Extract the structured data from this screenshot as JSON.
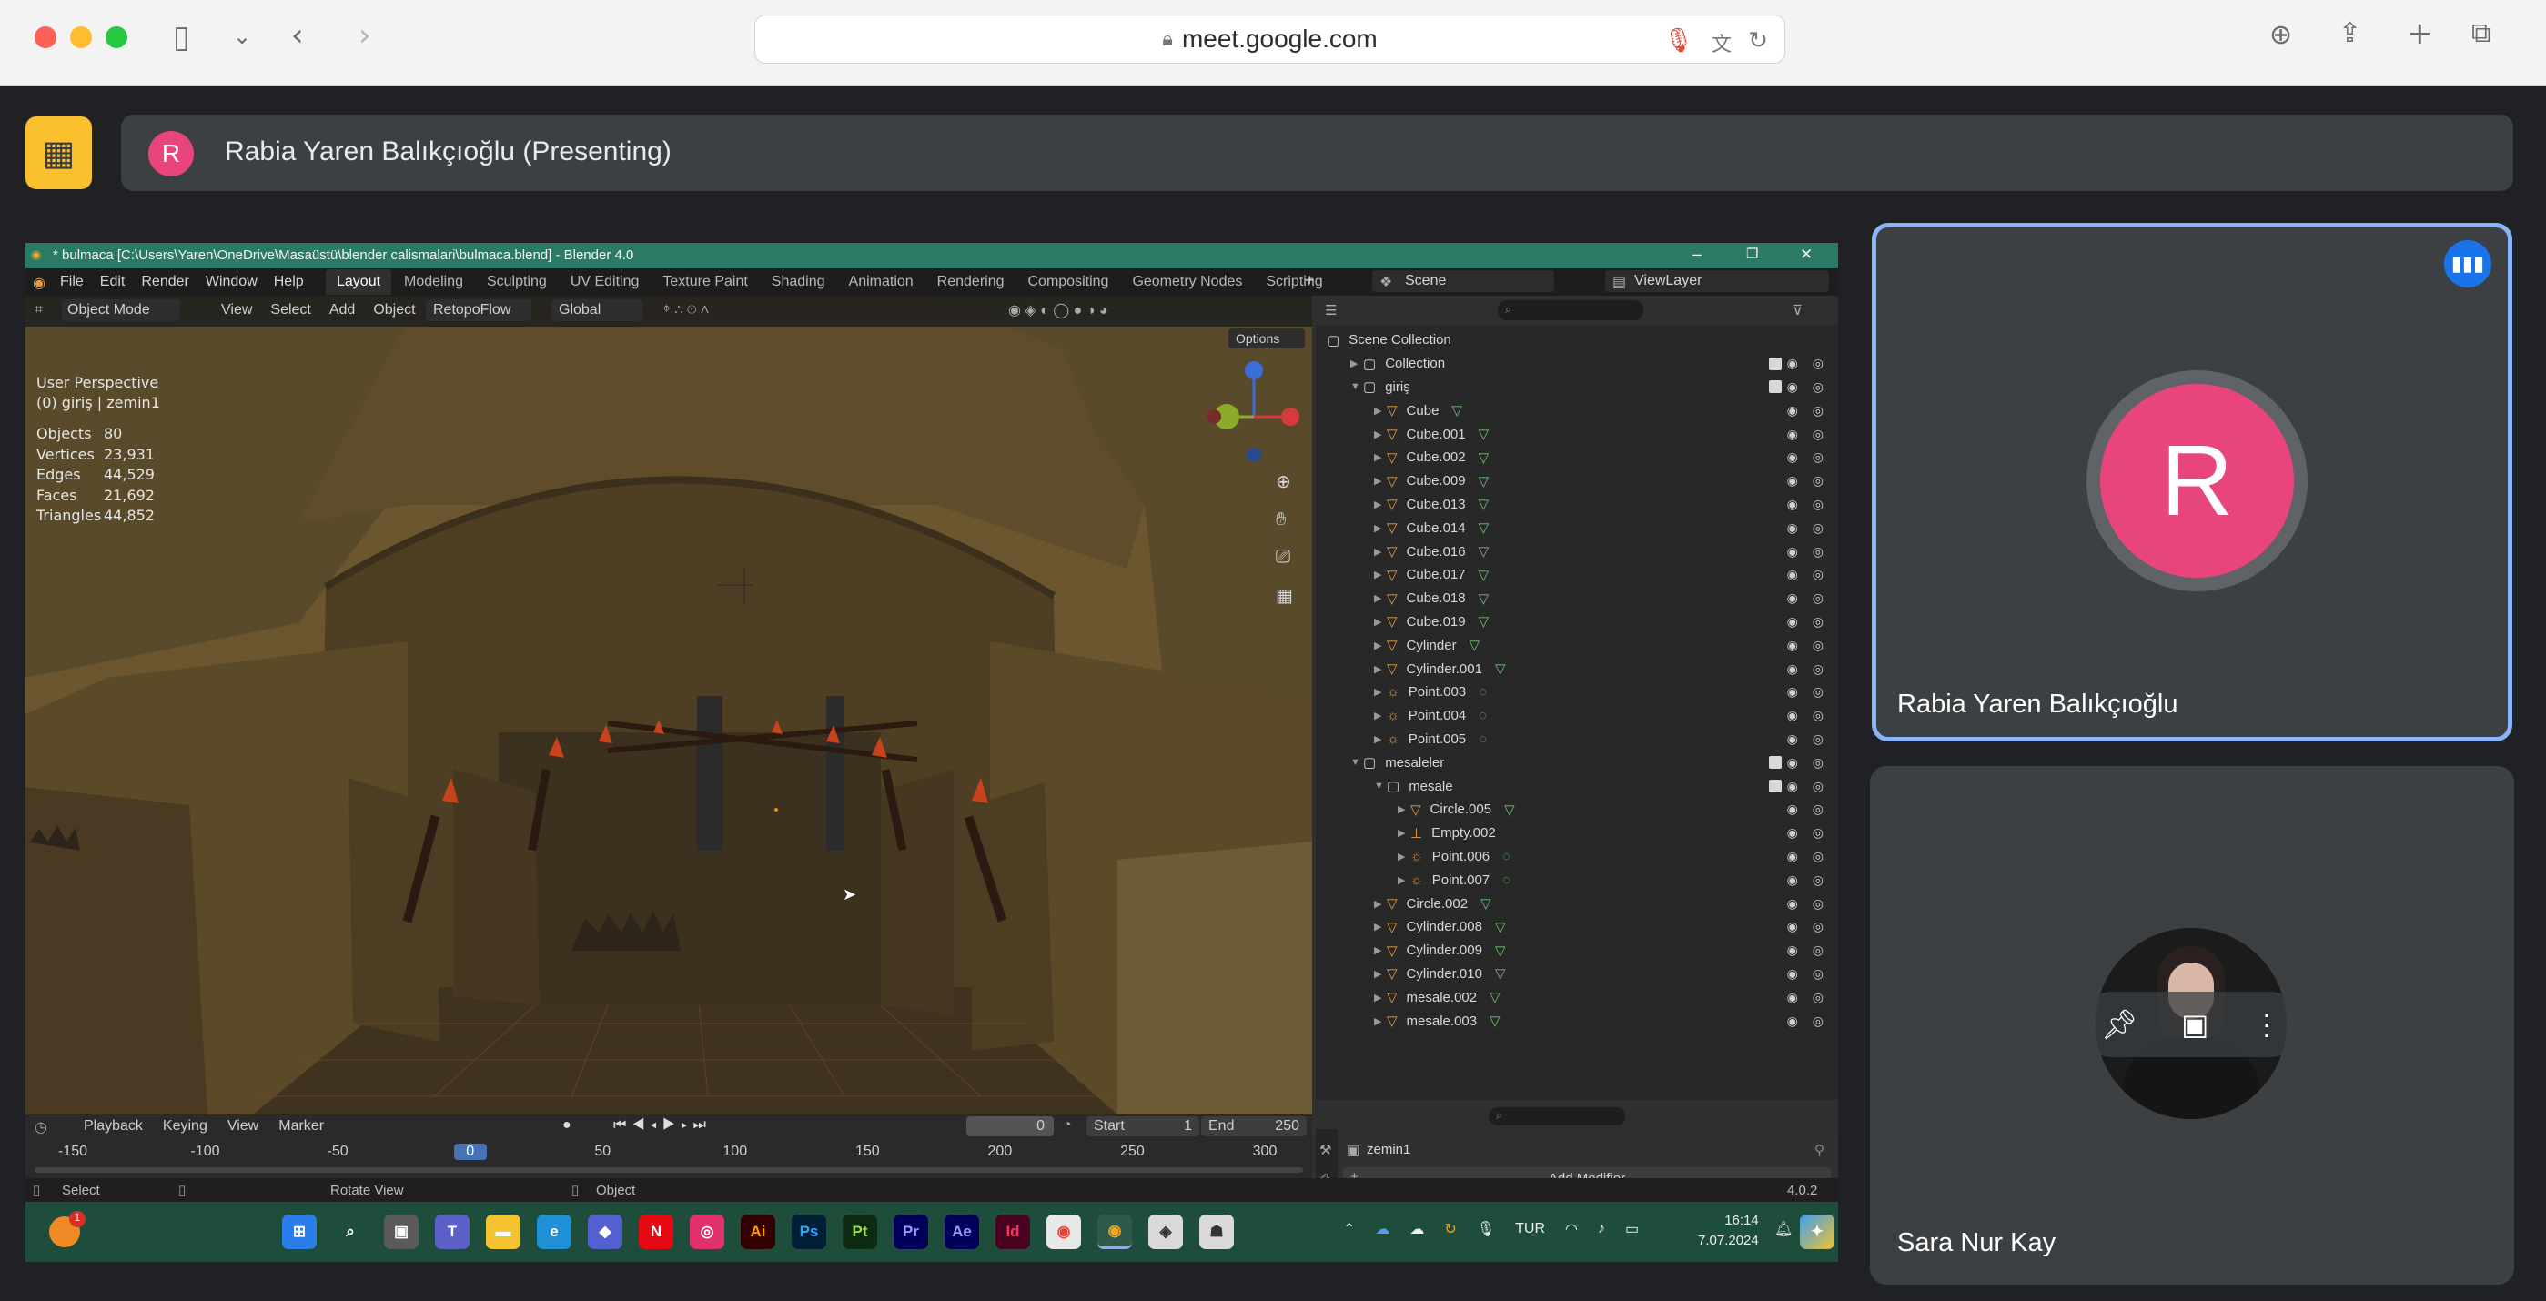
{
  "browser": {
    "url": "meet.google.com"
  },
  "meet": {
    "presenter_initial": "R",
    "presenting_label": "Rabia Yaren Balıkçıoğlu (Presenting)",
    "participants": [
      {
        "initial": "R",
        "name": "Rabia Yaren Balıkçıoğlu",
        "avatar_color": "#e8457c"
      },
      {
        "name": "Sara Nur Kay"
      }
    ],
    "accent": "#8ab4f8"
  },
  "blender": {
    "window_title": "* bulmaca [C:\\Users\\Yaren\\OneDrive\\Masaüstü\\blender calismalari\\bulmaca.blend] - Blender 4.0",
    "menu": [
      "File",
      "Edit",
      "Render",
      "Window",
      "Help"
    ],
    "workspaces": [
      "Layout",
      "Modeling",
      "Sculpting",
      "UV Editing",
      "Texture Paint",
      "Shading",
      "Animation",
      "Rendering",
      "Compositing",
      "Geometry Nodes",
      "Scripting"
    ],
    "active_workspace": "Layout",
    "scene": "Scene",
    "view_layer": "ViewLayer",
    "viewport_header": {
      "mode": "Object Mode",
      "items": [
        "View",
        "Select",
        "Add",
        "Object"
      ],
      "addon": "RetopoFlow",
      "transform": "Global",
      "options": "Options"
    },
    "overlay": {
      "perspective": "User Perspective",
      "context": "(0) giriş | zemin1",
      "stats": [
        {
          "label": "Objects",
          "value": "80"
        },
        {
          "label": "Vertices",
          "value": "23,931"
        },
        {
          "label": "Edges",
          "value": "44,529"
        },
        {
          "label": "Faces",
          "value": "21,692"
        },
        {
          "label": "Triangles",
          "value": "44,852"
        }
      ]
    },
    "outliner": [
      {
        "name": "Scene Collection",
        "indent": 0,
        "kind": "scene"
      },
      {
        "name": "Collection",
        "indent": 1,
        "kind": "collection",
        "check": true
      },
      {
        "name": "giriş",
        "indent": 1,
        "kind": "collection",
        "check": true,
        "open": true
      },
      {
        "name": "Cube",
        "indent": 2,
        "kind": "mesh"
      },
      {
        "name": "Cube.001",
        "indent": 2,
        "kind": "mesh"
      },
      {
        "name": "Cube.002",
        "indent": 2,
        "kind": "mesh"
      },
      {
        "name": "Cube.009",
        "indent": 2,
        "kind": "mesh"
      },
      {
        "name": "Cube.013",
        "indent": 2,
        "kind": "mesh"
      },
      {
        "name": "Cube.014",
        "indent": 2,
        "kind": "mesh"
      },
      {
        "name": "Cube.016",
        "indent": 2,
        "kind": "mesh"
      },
      {
        "name": "Cube.017",
        "indent": 2,
        "kind": "mesh"
      },
      {
        "name": "Cube.018",
        "indent": 2,
        "kind": "mesh"
      },
      {
        "name": "Cube.019",
        "indent": 2,
        "kind": "mesh"
      },
      {
        "name": "Cylinder",
        "indent": 2,
        "kind": "mesh"
      },
      {
        "name": "Cylinder.001",
        "indent": 2,
        "kind": "mesh"
      },
      {
        "name": "Point.003",
        "indent": 2,
        "kind": "light"
      },
      {
        "name": "Point.004",
        "indent": 2,
        "kind": "light"
      },
      {
        "name": "Point.005",
        "indent": 2,
        "kind": "light"
      },
      {
        "name": "mesaleler",
        "indent": 1,
        "kind": "collection",
        "check": true,
        "open": true
      },
      {
        "name": "mesale",
        "indent": 2,
        "kind": "collection",
        "check": true,
        "open": true
      },
      {
        "name": "Circle.005",
        "indent": 3,
        "kind": "mesh"
      },
      {
        "name": "Empty.002",
        "indent": 3,
        "kind": "empty"
      },
      {
        "name": "Point.006",
        "indent": 3,
        "kind": "light"
      },
      {
        "name": "Point.007",
        "indent": 3,
        "kind": "light"
      },
      {
        "name": "Circle.002",
        "indent": 2,
        "kind": "mesh"
      },
      {
        "name": "Cylinder.008",
        "indent": 2,
        "kind": "mesh"
      },
      {
        "name": "Cylinder.009",
        "indent": 2,
        "kind": "mesh"
      },
      {
        "name": "Cylinder.010",
        "indent": 2,
        "kind": "mesh"
      },
      {
        "name": "mesale.002",
        "indent": 2,
        "kind": "mesh"
      },
      {
        "name": "mesale.003",
        "indent": 2,
        "kind": "mesh"
      }
    ],
    "properties": {
      "object": "zemin1",
      "add_modifier": "Add Modifier"
    },
    "timeline": {
      "menus": [
        "Playback",
        "Keying",
        "View",
        "Marker"
      ],
      "current_frame": "0",
      "start_label": "Start",
      "start": "1",
      "end_label": "End",
      "end": "250",
      "ticks": [
        "-150",
        "-100",
        "-50",
        "0",
        "50",
        "100",
        "150",
        "200",
        "250",
        "300"
      ]
    },
    "statusbar": {
      "items": [
        "Select",
        "Rotate View",
        "Object"
      ],
      "version": "4.0.2"
    }
  },
  "taskbar": {
    "icons": [
      "N",
      "Ai",
      "Ps",
      "Pt",
      "Pr",
      "Ae",
      "Id"
    ],
    "lang": "TUR",
    "time": "16:14",
    "date": "7.07.2024",
    "notification_count": "1"
  }
}
